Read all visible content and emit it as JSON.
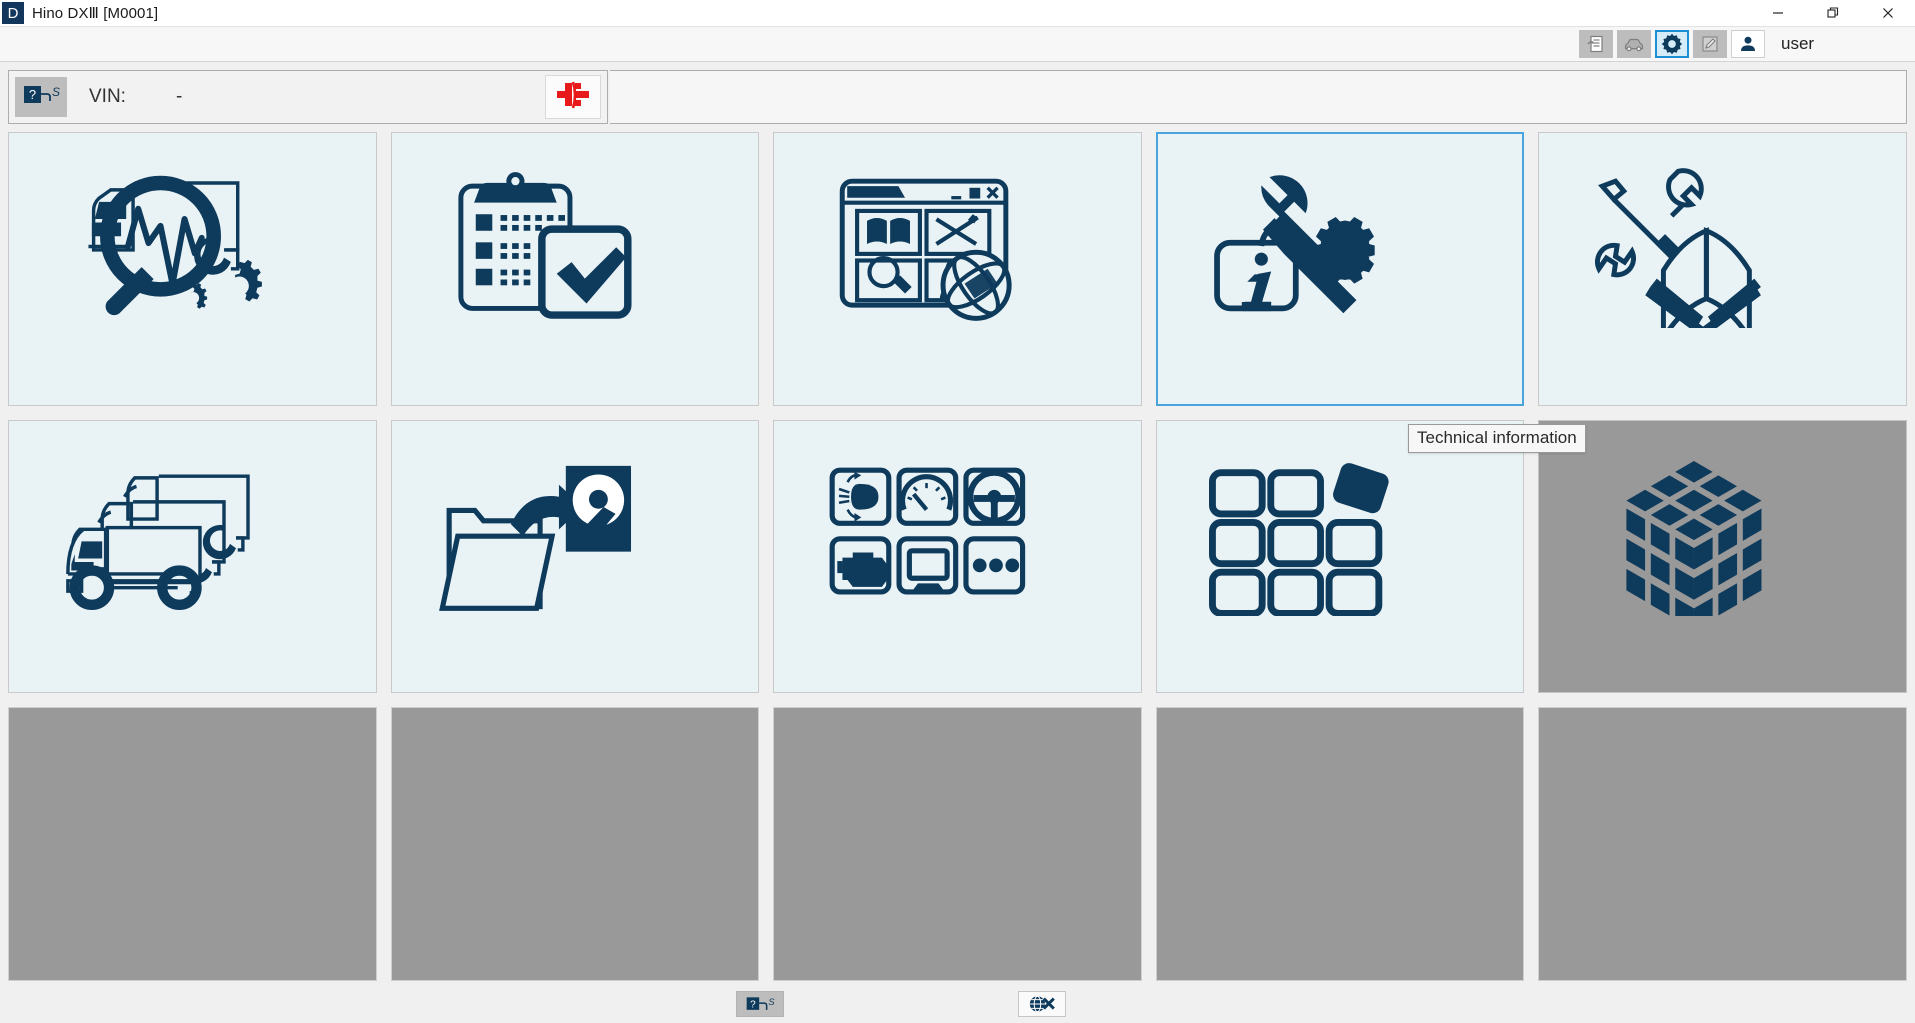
{
  "window": {
    "title": "Hino DXⅢ [M0001]",
    "app_icon": "app-d-icon",
    "controls": [
      {
        "name": "minimize-button",
        "icon": "minimize-icon"
      },
      {
        "name": "restore-button",
        "icon": "restore-icon"
      },
      {
        "name": "close-button",
        "icon": "close-icon"
      }
    ]
  },
  "toolbar": {
    "buttons": [
      {
        "name": "report-export-button",
        "icon": "document-export-icon",
        "state": "disabled"
      },
      {
        "name": "vehicle-info-button",
        "icon": "vehicle-icon",
        "state": "disabled"
      },
      {
        "name": "settings-button",
        "icon": "gear-icon",
        "state": "active"
      },
      {
        "name": "edit-note-button",
        "icon": "pen-edit-icon",
        "state": "disabled"
      },
      {
        "name": "user-account-button",
        "icon": "person-icon",
        "state": "enabled"
      }
    ],
    "user_label": "user"
  },
  "vin_bar": {
    "help_icon": "question-s-icon",
    "label": "VIN:",
    "value": "-",
    "connection_icon": "disconnected-plug-icon",
    "connection_state": "disconnected"
  },
  "tiles": [
    {
      "name": "tile-vehicle-diagnosis",
      "icon": "truck-magnifier-waveform-gears-icon",
      "state": "enabled"
    },
    {
      "name": "tile-inspection-checklist",
      "icon": "clipboard-checkmark-icon",
      "state": "enabled"
    },
    {
      "name": "tile-online-portal",
      "icon": "browser-window-globe-icon",
      "state": "enabled"
    },
    {
      "name": "tile-technical-information",
      "icon": "info-bubble-wrench-gear-icon",
      "state": "hovered"
    },
    {
      "name": "tile-service-manual",
      "icon": "book-screwdriver-wrench-icon",
      "state": "enabled"
    },
    {
      "name": "tile-vehicle-selection",
      "icon": "three-trucks-icon",
      "state": "enabled"
    },
    {
      "name": "tile-data-backup",
      "icon": "folder-arrow-harddisk-icon",
      "state": "enabled"
    },
    {
      "name": "tile-system-functions",
      "icon": "six-function-grid-icon",
      "state": "enabled"
    },
    {
      "name": "tile-module-layout",
      "icon": "nine-square-grid-detached-icon",
      "state": "enabled"
    },
    {
      "name": "tile-3d-module-cube",
      "icon": "isometric-cube-icon",
      "state": "disabled"
    },
    {
      "name": "tile-empty-1",
      "icon": "",
      "state": "empty"
    },
    {
      "name": "tile-empty-2",
      "icon": "",
      "state": "empty"
    },
    {
      "name": "tile-empty-3",
      "icon": "",
      "state": "empty"
    },
    {
      "name": "tile-empty-4",
      "icon": "",
      "state": "empty"
    },
    {
      "name": "tile-empty-5",
      "icon": "",
      "state": "empty"
    }
  ],
  "tooltip": {
    "text": "Technical information",
    "visible": true
  },
  "bottom_bar": {
    "help_button": {
      "name": "help-button",
      "icon": "question-s-icon",
      "state": "disabled"
    },
    "offline_button": {
      "name": "go-offline-button",
      "icon": "globe-disconnect-icon",
      "state": "enabled"
    }
  },
  "colors": {
    "accent_navy": "#0e3a5c",
    "tile_background": "#e9f3f6",
    "disabled_gray": "#999999",
    "hover_border": "#4ba3dd",
    "active_toolbar": "#1a8fd4",
    "alert_red": "#e8191b"
  }
}
